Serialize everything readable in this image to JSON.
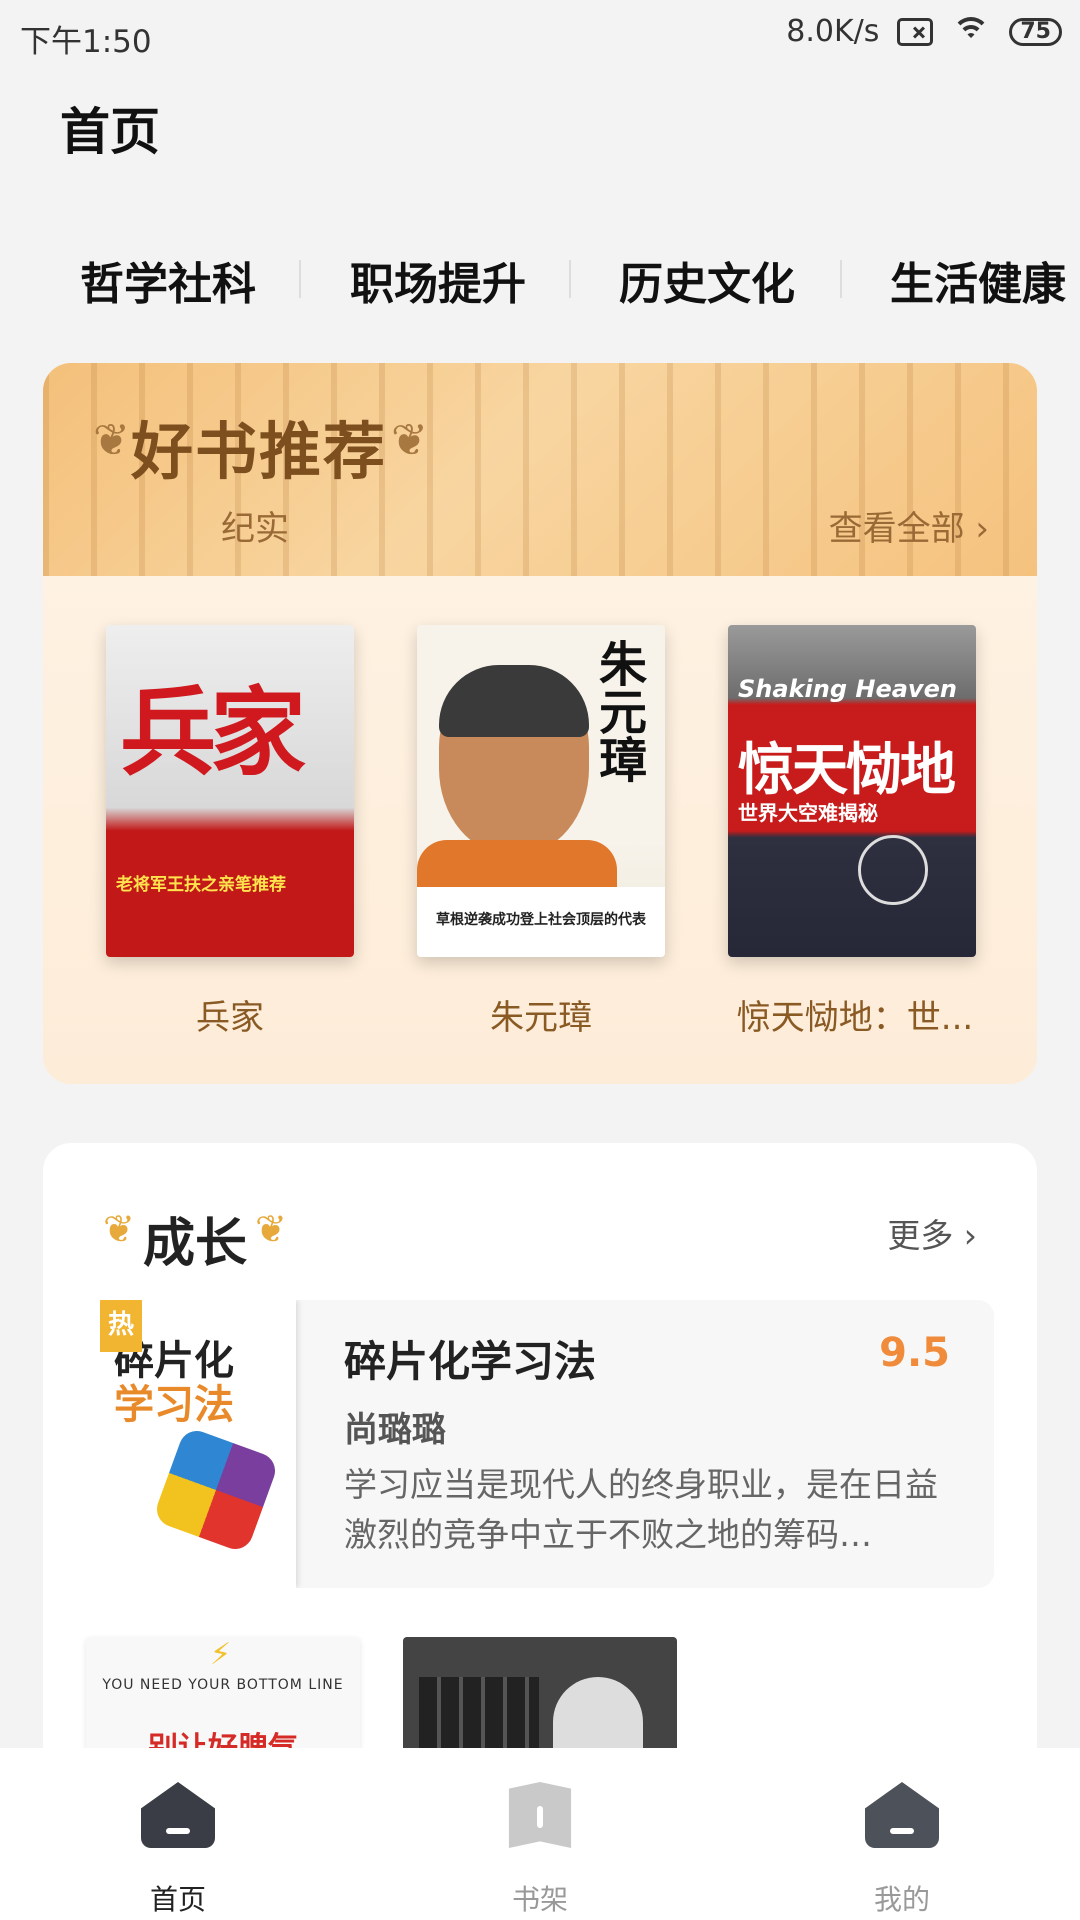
{
  "status_bar": {
    "time": "下午1:50",
    "network_speed": "8.0K/s",
    "battery": "75"
  },
  "header": {
    "title": "首页"
  },
  "categories": [
    "哲学社科",
    "职场提升",
    "历史文化",
    "生活健康"
  ],
  "recommend": {
    "title": "好书推荐",
    "subtitle": "纪实",
    "more": "查看全部 ›",
    "books": [
      {
        "title": "兵家",
        "cover_text": "兵家",
        "cover_band": "老将军王扶之亲笔推荐"
      },
      {
        "title": "朱元璋",
        "cover_text": "朱元璋",
        "cover_band": "草根逆袭成功登上社会顶层的代表"
      },
      {
        "title": "惊天恸地：世...",
        "cover_text": "惊天恸地",
        "cover_en": "Shaking Heaven",
        "cover_band": "世界大空难揭秘"
      }
    ]
  },
  "growth": {
    "title": "成长",
    "more": "更多 ›",
    "featured": {
      "hot_badge": "热",
      "cover_line1": "碎片化",
      "cover_line2": "学习法",
      "name": "碎片化学习法",
      "score": "9.5",
      "author": "尚璐璐",
      "description": "学习应当是现代人的终身职业，是在日益激烈的竞争中立于不败之地的筹码…"
    },
    "more_books": [
      {
        "cover_en": "YOU NEED YOUR BOTTOM LINE",
        "cover_zh": "别让好脾气"
      }
    ]
  },
  "bottom_nav": [
    {
      "label": "首页",
      "icon": "home-icon",
      "active": true
    },
    {
      "label": "书架",
      "icon": "bookshelf-icon",
      "active": false
    },
    {
      "label": "我的",
      "icon": "profile-icon",
      "active": false
    }
  ],
  "colors": {
    "accent_orange": "#ef8b3a",
    "banner_gold": "#f4c07a",
    "text_brown": "#8a5a24",
    "nav_active": "#222222",
    "nav_inactive": "#999999"
  }
}
